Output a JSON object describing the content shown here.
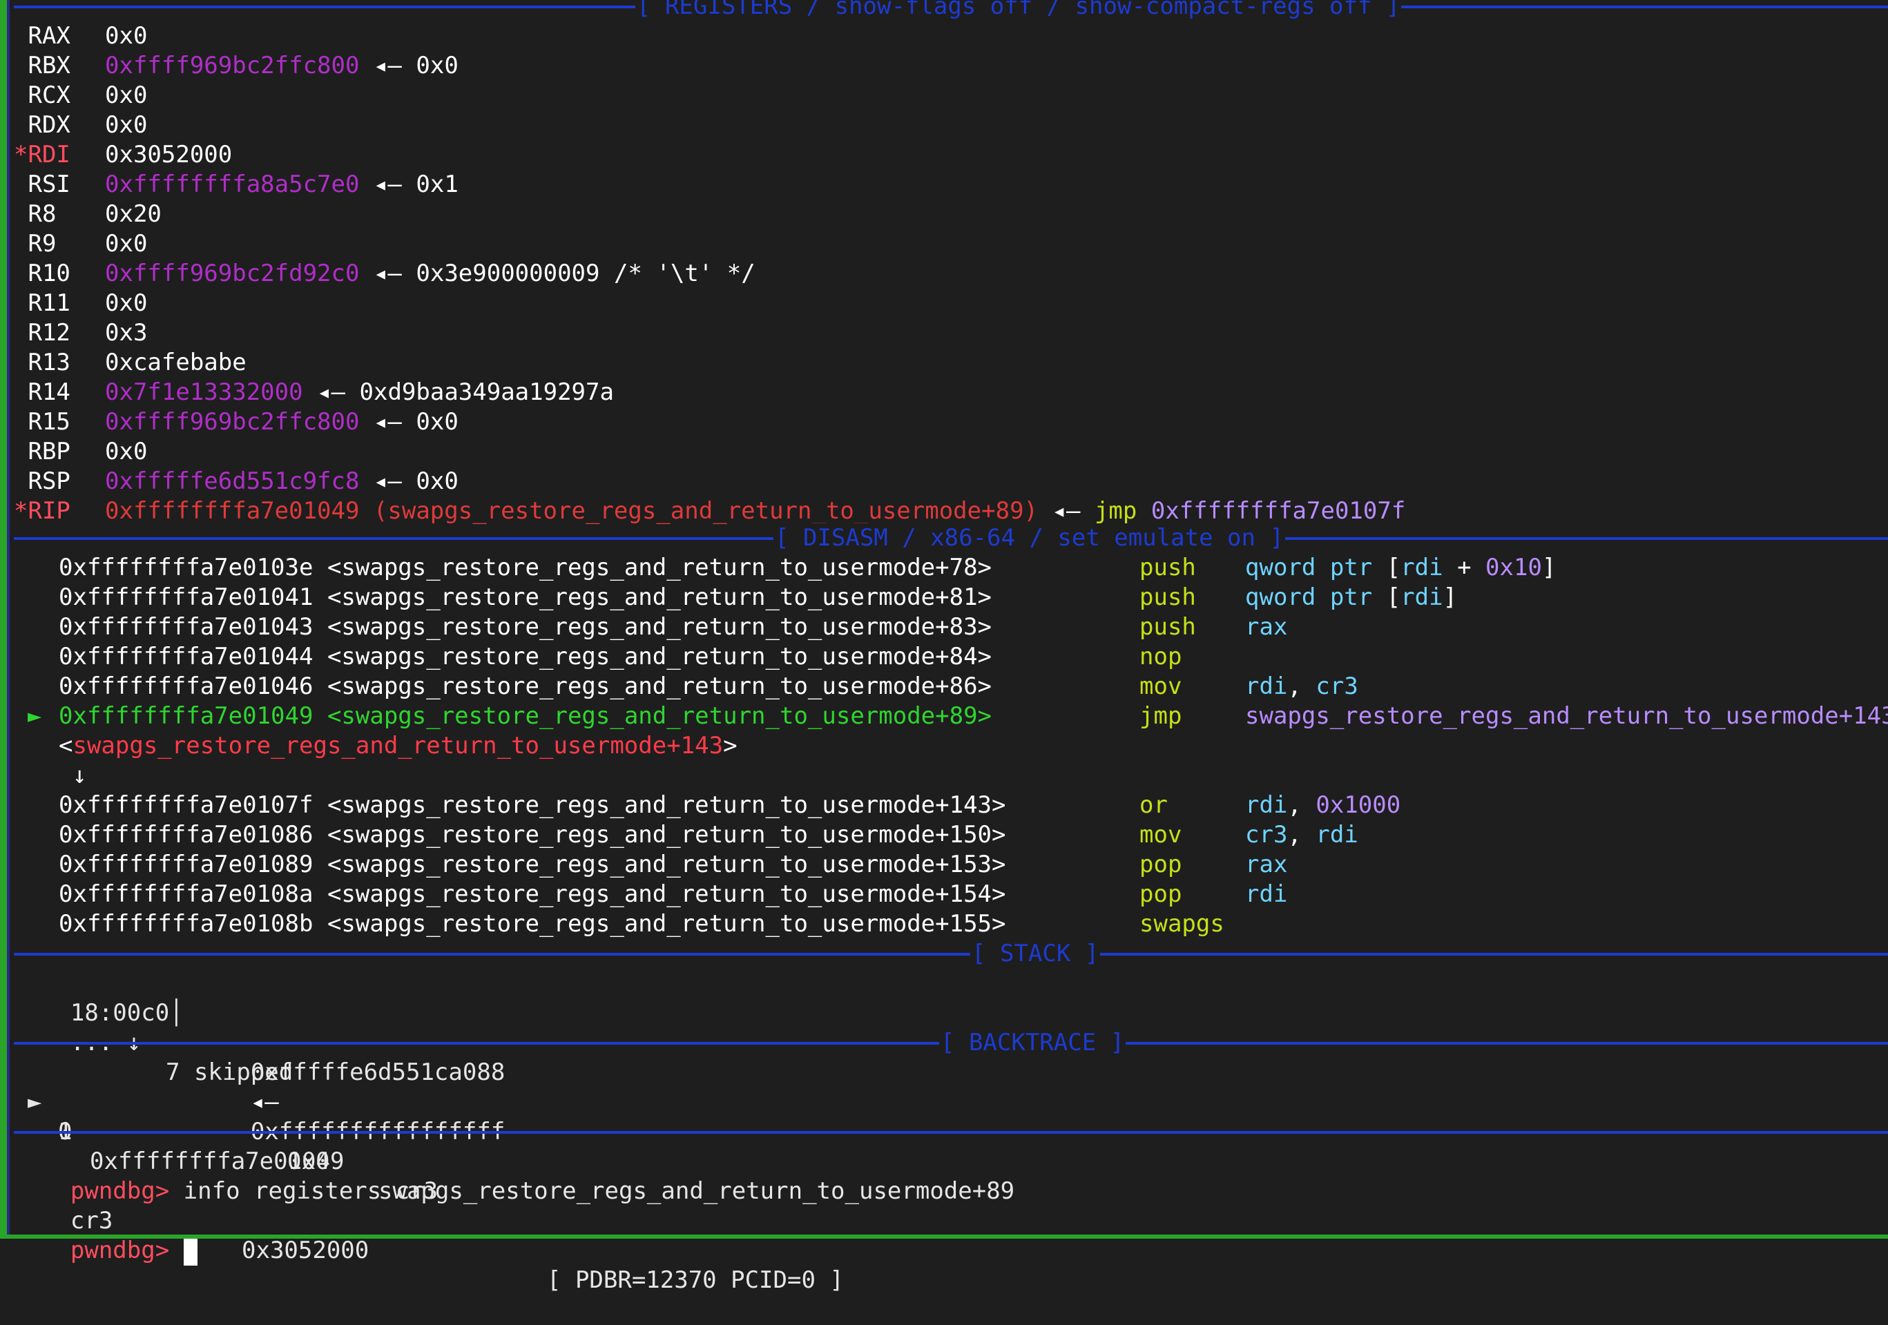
{
  "sections": {
    "registers": "[ REGISTERS / show-flags off / show-compact-regs off ]",
    "disasm": "[ DISASM / x86-64 / set emulate on ]",
    "stack": "[ STACK ]",
    "backtrace": "[ BACKTRACE ]"
  },
  "registers": [
    {
      "mark": " ",
      "name": "RAX",
      "value": "0x0"
    },
    {
      "mark": " ",
      "name": "RBX",
      "value": "0xffff969bc2ffc800",
      "arrow": "◂—",
      "target": "0x0"
    },
    {
      "mark": " ",
      "name": "RCX",
      "value": "0x0"
    },
    {
      "mark": " ",
      "name": "RDX",
      "value": "0x0"
    },
    {
      "mark": "*",
      "name": "RDI",
      "value": "0x3052000"
    },
    {
      "mark": " ",
      "name": "RSI",
      "value": "0xffffffffa8a5c7e0",
      "arrow": "◂—",
      "target": "0x1"
    },
    {
      "mark": " ",
      "name": "R8",
      "value": "0x20"
    },
    {
      "mark": " ",
      "name": "R9",
      "value": "0x0"
    },
    {
      "mark": " ",
      "name": "R10",
      "value": "0xffff969bc2fd92c0",
      "arrow": "◂—",
      "target": "0x3e900000009 /* '\\t' */"
    },
    {
      "mark": " ",
      "name": "R11",
      "value": "0x0"
    },
    {
      "mark": " ",
      "name": "R12",
      "value": "0x3"
    },
    {
      "mark": " ",
      "name": "R13",
      "value": "0xcafebabe"
    },
    {
      "mark": " ",
      "name": "R14",
      "value": "0x7f1e13332000",
      "arrow": "◂—",
      "target": "0xd9baa349aa19297a"
    },
    {
      "mark": " ",
      "name": "R15",
      "value": "0xffff969bc2ffc800",
      "arrow": "◂—",
      "target": "0x0"
    },
    {
      "mark": " ",
      "name": "RBP",
      "value": "0x0"
    },
    {
      "mark": " ",
      "name": "RSP",
      "value": "0xfffffe6d551c9fc8",
      "arrow": "◂—",
      "target": "0x0"
    },
    {
      "mark": "*",
      "name": "RIP",
      "value": "0xffffffffa7e01049 (swapgs_restore_regs_and_return_to_usermode+89)",
      "arrow": "◂—",
      "target_mn": "jmp",
      "target": "0xffffffffa7e0107f"
    }
  ],
  "disasm": [
    {
      "cur": " ",
      "addr": "0xffffffffa7e0103e",
      "sym": "<swapgs_restore_regs_and_return_to_usermode+78>",
      "pad": "     ",
      "mn": "push",
      "ops": "qword ptr [rdi + 0x10]"
    },
    {
      "cur": " ",
      "addr": "0xffffffffa7e01041",
      "sym": "<swapgs_restore_regs_and_return_to_usermode+81>",
      "pad": "     ",
      "mn": "push",
      "ops": "qword ptr [rdi]"
    },
    {
      "cur": " ",
      "addr": "0xffffffffa7e01043",
      "sym": "<swapgs_restore_regs_and_return_to_usermode+83>",
      "pad": "     ",
      "mn": "push",
      "ops": "rax"
    },
    {
      "cur": " ",
      "addr": "0xffffffffa7e01044",
      "sym": "<swapgs_restore_regs_and_return_to_usermode+84>",
      "pad": "     ",
      "mn": "nop",
      "ops": ""
    },
    {
      "cur": " ",
      "addr": "0xffffffffa7e01046",
      "sym": "<swapgs_restore_regs_and_return_to_usermode+86>",
      "pad": "     ",
      "mn": "mov",
      "ops": "rdi, cr3"
    },
    {
      "cur": "►",
      "addr": "0xffffffffa7e01049",
      "sym": "<swapgs_restore_regs_and_return_to_usermode+89>",
      "pad": "     ",
      "mn": "jmp",
      "ops": "swapgs_restore_regs_and_return_to_usermode+143"
    },
    {
      "cur": " ",
      "addr": "0xffffffffa7e0107f",
      "sym": "<swapgs_restore_regs_and_return_to_usermode+143>",
      "pad": "    ",
      "mn": "or",
      "ops": "rdi, 0x1000"
    },
    {
      "cur": " ",
      "addr": "0xffffffffa7e01086",
      "sym": "<swapgs_restore_regs_and_return_to_usermode+150>",
      "pad": "    ",
      "mn": "mov",
      "ops": "cr3, rdi"
    },
    {
      "cur": " ",
      "addr": "0xffffffffa7e01089",
      "sym": "<swapgs_restore_regs_and_return_to_usermode+153>",
      "pad": "    ",
      "mn": "pop",
      "ops": "rax"
    },
    {
      "cur": " ",
      "addr": "0xffffffffa7e0108a",
      "sym": "<swapgs_restore_regs_and_return_to_usermode+154>",
      "pad": "    ",
      "mn": "pop",
      "ops": "rdi"
    },
    {
      "cur": " ",
      "addr": "0xffffffffa7e0108b",
      "sym": "<swapgs_restore_regs_and_return_to_usermode+155>",
      "pad": "    ",
      "mn": "swapgs",
      "ops": ""
    }
  ],
  "jmp_target_line": {
    "open": "<",
    "sym": "swapgs_restore_regs_and_return_to_usermode+143",
    "close": ">"
  },
  "down_arrow": "↓",
  "stack": [
    {
      "offset": "18:00c0│",
      "addr": "0xfffffe6d551ca088",
      "arrow": "◂—",
      "value": "0xffffffffffffffff"
    },
    {
      "offset": "... ↓",
      "text": "7 skipped"
    }
  ],
  "backtrace": [
    {
      "cur": "►",
      "idx": "0",
      "addr": "0xffffffffa7e01049",
      "sym": "swapgs_restore_regs_and_return_to_usermode+89"
    },
    {
      "cur": " ",
      "idx": "1",
      "addr": "0x0",
      "sym": ""
    }
  ],
  "console": {
    "prompt": "pwndbg>",
    "command": "info registers cr3",
    "output_name": "cr3",
    "output_value": "0x3052000",
    "output_info": "[ PDBR=12370 PCID=0 ]"
  }
}
